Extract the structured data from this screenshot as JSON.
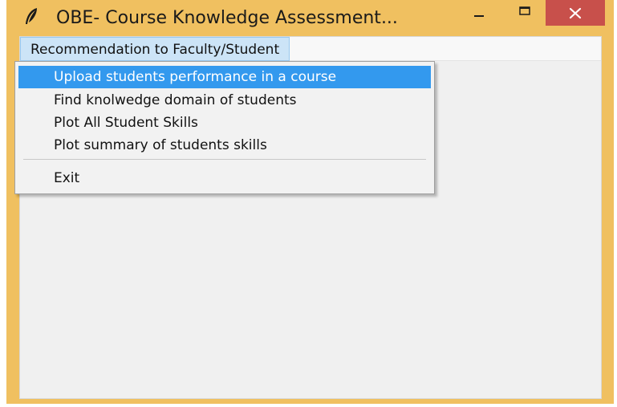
{
  "window": {
    "title": "OBE- Course Knowledge Assessment...",
    "app_icon": "feather-icon",
    "controls": {
      "minimize": "minimize-icon",
      "maximize": "maximize-icon",
      "close": "close-icon"
    },
    "colors": {
      "frame": "#f0c060",
      "close_button": "#c8504b",
      "client_bg": "#f0f0f0",
      "menu_highlight": "#3399ee",
      "menubar_highlight": "#cce4f7"
    }
  },
  "menubar": {
    "items": [
      {
        "label": "Recommendation to Faculty/Student"
      }
    ]
  },
  "dropdown": {
    "items": [
      {
        "label": "Upload students performance in a course",
        "selected": true
      },
      {
        "label": "Find knolwedge domain of students"
      },
      {
        "label": "Plot All Student Skills"
      },
      {
        "label": "Plot summary of students skills"
      },
      {
        "label": "Exit"
      }
    ]
  }
}
